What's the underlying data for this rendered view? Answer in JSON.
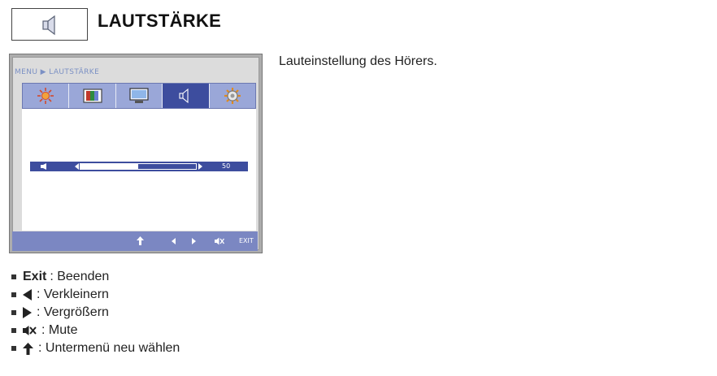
{
  "header": {
    "title": "LAUTSTÄRKE",
    "icon": "speaker-icon"
  },
  "description": "Lauteinstellung des Hörers.",
  "osd": {
    "breadcrumb": "MENU ▶ LAUTSTÄRKE",
    "tabs": [
      {
        "name": "brightness",
        "icon": "sun-icon"
      },
      {
        "name": "color",
        "icon": "color-bars-icon"
      },
      {
        "name": "display",
        "icon": "monitor-icon"
      },
      {
        "name": "volume",
        "icon": "speaker-icon",
        "active": true
      },
      {
        "name": "setup",
        "icon": "gear-icon"
      }
    ],
    "slider": {
      "value": "50",
      "fill_fraction": 0.5
    },
    "footer": {
      "exit_label": "EXIT",
      "buttons": [
        "up-arrow-icon",
        "left-arrow-icon",
        "right-arrow-icon",
        "mute-icon"
      ]
    }
  },
  "legend": [
    {
      "key": "Exit",
      "text": ": Beenden"
    },
    {
      "icon": "left-arrow-icon",
      "text": ": Verkleinern"
    },
    {
      "icon": "right-arrow-icon",
      "text": ": Vergrößern"
    },
    {
      "icon": "mute-icon",
      "text": ": Mute"
    },
    {
      "icon": "up-arrow-icon",
      "text": ": Untermenü neu wählen"
    }
  ],
  "colors": {
    "accent": "#3d4d9e",
    "tab_bar": "#9aa7d8",
    "footer": "#7b87c2",
    "breadcrumb": "#7b90c4"
  }
}
